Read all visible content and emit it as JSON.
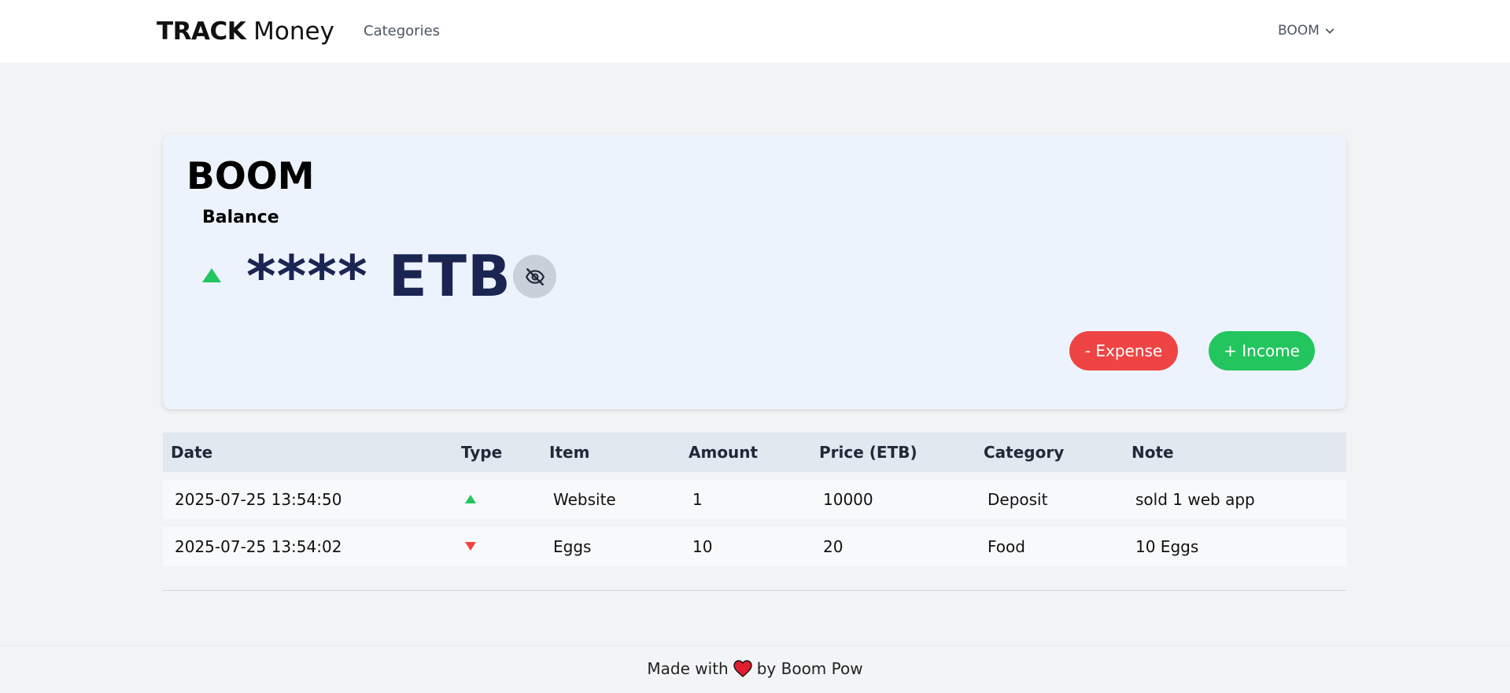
{
  "navbar": {
    "brand_bold": "TRACK",
    "brand_light": "Money",
    "links": [
      "Categories"
    ],
    "user": "BOOM"
  },
  "card": {
    "account_name": "BOOM",
    "balance_label": "Balance",
    "balance_value": "**** ETB",
    "trend": "up",
    "expense_button": "- Expense",
    "income_button": "+ Income"
  },
  "table": {
    "headers": [
      "Date",
      "Type",
      "Item",
      "Amount",
      "Price (ETB)",
      "Category",
      "Note"
    ],
    "rows": [
      {
        "date": "2025-07-25 13:54:50",
        "type": "income",
        "item": "Website",
        "amount": "1",
        "price": "10000",
        "category": "Deposit",
        "note": "sold 1 web app"
      },
      {
        "date": "2025-07-25 13:54:02",
        "type": "expense",
        "item": "Eggs",
        "amount": "10",
        "price": "20",
        "category": "Food",
        "note": "10 Eggs"
      }
    ]
  },
  "footer": {
    "before": "Made with",
    "after": "by Boom Pow"
  },
  "colors": {
    "income": "#22c55e",
    "expense": "#ef4444",
    "balance": "#1b2552",
    "card_bg": "#ecf3fc"
  },
  "icons": {
    "toggle": "eye-slash-icon",
    "footer": "heart-icon",
    "user_menu": "chevron-down-icon"
  }
}
